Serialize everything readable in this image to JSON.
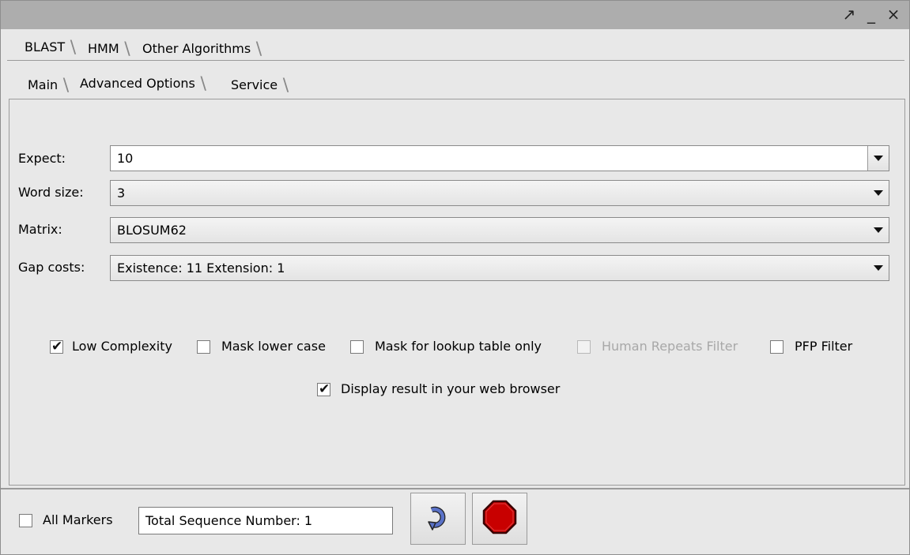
{
  "window_controls": {
    "restore_glyph": "↗",
    "minimize_glyph": "_",
    "close_glyph": "×"
  },
  "outer_tabs": [
    {
      "label": "BLAST",
      "active": true
    },
    {
      "label": "HMM",
      "active": false
    },
    {
      "label": "Other Algorithms",
      "active": false
    }
  ],
  "inner_tabs": [
    {
      "label": "Main",
      "active": false
    },
    {
      "label": "Advanced Options",
      "active": true
    },
    {
      "label": "Service",
      "active": false
    }
  ],
  "fields": {
    "expect": {
      "label": "Expect:",
      "value": "10"
    },
    "word_size": {
      "label": "Word size:",
      "value": "3"
    },
    "matrix": {
      "label": "Matrix:",
      "value": "BLOSUM62"
    },
    "gap_costs": {
      "label": "Gap costs:",
      "value": "Existence: 11 Extension: 1"
    }
  },
  "checkboxes": {
    "low_complexity": {
      "label": "Low Complexity",
      "checked": true
    },
    "mask_lower_case": {
      "label": "Mask lower case",
      "checked": false
    },
    "mask_lookup": {
      "label": "Mask for lookup table only",
      "checked": false
    },
    "human_repeats": {
      "label": "Human Repeats Filter",
      "checked": false,
      "disabled": true
    },
    "pfp_filter": {
      "label": "PFP Filter",
      "checked": false
    },
    "display_browser": {
      "label": "Display result in your web browser",
      "checked": true
    }
  },
  "bottom": {
    "all_markers_label": "All Markers",
    "all_markers_checked": false,
    "total_sequence": "Total Sequence Number: 1"
  },
  "colors": {
    "stop_red": "#c80000",
    "refresh_blue": "#4a5fb0"
  },
  "icons": {
    "run": "refresh-arrow-icon",
    "stop": "stop-octagon-icon"
  }
}
